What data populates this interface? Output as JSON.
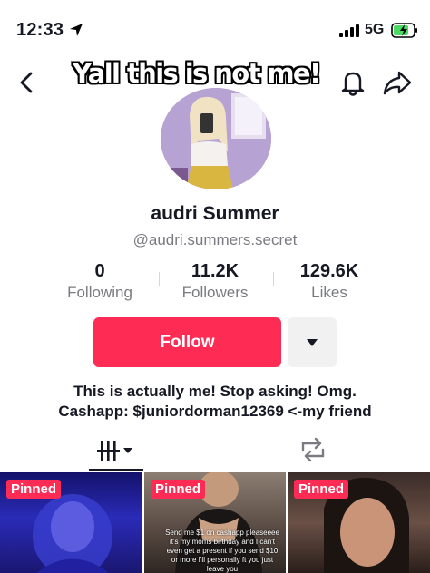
{
  "status_bar": {
    "time": "12:33",
    "network": "5G",
    "icons": [
      "location-arrow-icon",
      "cellular-signal-icon",
      "battery-charging-icon"
    ]
  },
  "nav": {
    "back_icon": "chevron-left-icon",
    "bell_icon": "bell-icon",
    "share_icon": "share-arrow-icon"
  },
  "overlay_caption": "Yall this is not me!",
  "profile": {
    "display_name": "audri Summer",
    "username": "@audri.summers.secret"
  },
  "stats": [
    {
      "value": "0",
      "label": "Following"
    },
    {
      "value": "11.2K",
      "label": "Followers"
    },
    {
      "value": "129.6K",
      "label": "Likes"
    }
  ],
  "actions": {
    "follow_label": "Follow",
    "more_icon": "caret-down-icon"
  },
  "bio": [
    "This is actually me! Stop asking! Omg.",
    "Cashapp: $juniordorman12369 <-my friend"
  ],
  "tabs": [
    {
      "name": "videos",
      "icon": "video-grid-icon",
      "active": true
    },
    {
      "name": "reposts",
      "icon": "repost-icon",
      "active": false
    }
  ],
  "videos": [
    {
      "badge": "Pinned",
      "caption": ""
    },
    {
      "badge": "Pinned",
      "caption": "Send me $1 on cashapp pleaseeee it's my moms birthday and I can't even get a present if you send $10 or more I'll personally ft you just leave you"
    },
    {
      "badge": "Pinned",
      "caption": ""
    }
  ],
  "colors": {
    "accent": "#fe2c55",
    "text": "#161823",
    "secondary": "#7a7b80",
    "more_button_bg": "#f1f1f2"
  }
}
